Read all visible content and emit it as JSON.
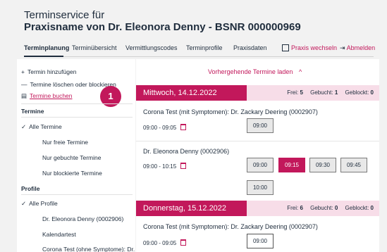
{
  "header": {
    "subtitle": "Terminservice für",
    "title": "Praxisname von Dr. Eleonora Denny - BSNR 000000969"
  },
  "nav": {
    "tabs": [
      "Terminplanung",
      "Terminübersicht",
      "Vermittlungscodes",
      "Terminprofile",
      "Praxisdaten"
    ],
    "switch_practice": "Praxis wechseln",
    "logout": "Abmelden"
  },
  "sidebar": {
    "add": "Termin hinzufügen",
    "delete_block": "Termine löschen oder blockieren",
    "book": "Termine buchen",
    "badge": "1",
    "section_termine": "Termine",
    "termine_items": [
      "Alle Termine",
      "Nur freie Termine",
      "Nur gebuchte Termine",
      "Nur blockierte Termine"
    ],
    "section_profile": "Profile",
    "profile_items": [
      "Alle Profile",
      "Dr. Eleonora Denny (0002906)",
      "Kalendartest",
      "Corona Test (ohne Symptome): Dr. Z"
    ]
  },
  "main": {
    "prev_label": "Vorhergehende Termine laden",
    "days": [
      {
        "title": "Mittwoch, 14.12.2022",
        "free_label": "Frei:",
        "free": "5",
        "booked_label": "Gebucht:",
        "booked": "1",
        "blocked_label": "Geblockt:",
        "blocked": "0",
        "groups": [
          {
            "title": "Corona Test (mit Symptomen): Dr. Zackary Deering (0002907)",
            "time": "09:00 - 09:05",
            "slots": [
              "09:00"
            ]
          },
          {
            "title": "Dr. Eleonora Denny (0002906)",
            "time": "09:00 - 10:15",
            "slots": [
              "09:00",
              "09:15",
              "09:30",
              "09:45",
              "10:00"
            ]
          }
        ]
      },
      {
        "title": "Donnerstag, 15.12.2022",
        "free_label": "Frei:",
        "free": "6",
        "booked_label": "Gebucht:",
        "booked": "0",
        "blocked_label": "Geblockt:",
        "blocked": "0",
        "groups": [
          {
            "title": "Corona Test (mit Symptomen): Dr. Zackary Deering (0002907)",
            "time": "09:00 - 09:05",
            "slots": [
              "09:00"
            ]
          }
        ]
      }
    ]
  },
  "colors": {
    "accent": "#c2185b",
    "accent_light": "#f7dde8",
    "text": "#1f2d3d"
  }
}
